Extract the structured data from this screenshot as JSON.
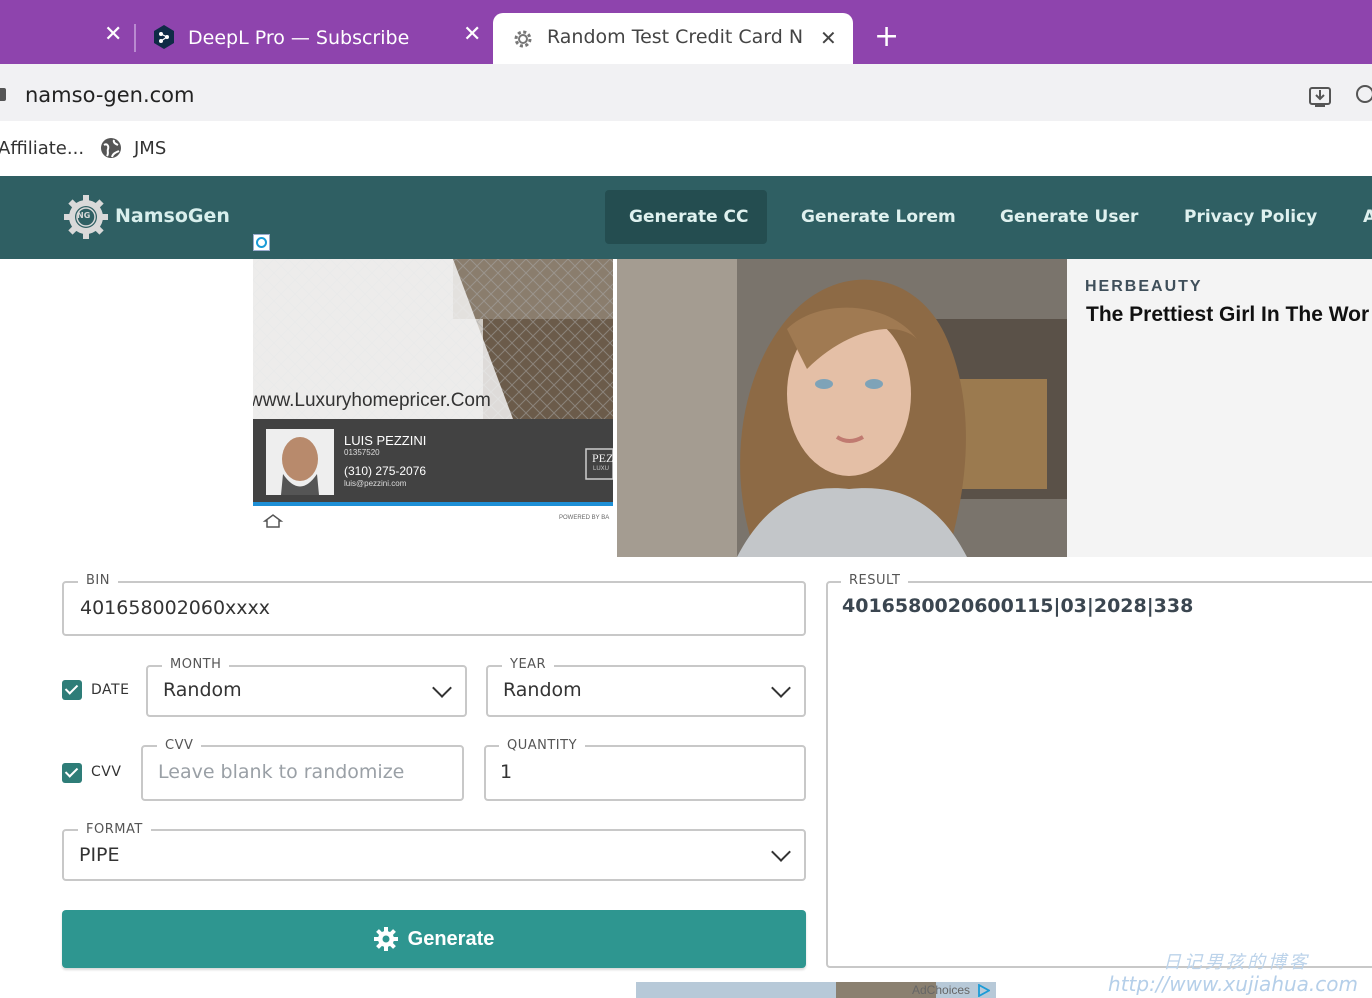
{
  "browser": {
    "tabs": [
      {
        "title": ""
      },
      {
        "title": "DeepL Pro — Subscribe"
      },
      {
        "title": "Random Test Credit Card Nun",
        "active": true
      }
    ],
    "url": "namso-gen.com",
    "bookmarks": [
      {
        "label": "Affiliate..."
      },
      {
        "label": "JMS"
      }
    ]
  },
  "site": {
    "brand": "NamsoGen",
    "logo_badge": "NG",
    "nav": [
      {
        "label": "Generate CC",
        "active": true
      },
      {
        "label": "Generate Lorem"
      },
      {
        "label": "Generate User"
      },
      {
        "label": "Privacy Policy"
      },
      {
        "label": "A"
      }
    ]
  },
  "ads": {
    "left": {
      "url_text": "www.Luxuryhomepricer.Com",
      "name": "LUIS PEZZINI",
      "license": "01357520",
      "phone": "(310) 275-2076",
      "email": "luis@pezzini.com",
      "logo_text": "PEZ",
      "logo_sub": "LUXU",
      "powered": "POWERED BY BA"
    },
    "right": {
      "sponsor": "HERBEAUTY",
      "headline": "The Prettiest Girl In The Wor"
    },
    "bottom": {
      "label": "AdChoices"
    }
  },
  "form": {
    "bin": {
      "label": "BIN",
      "value": "401658002060xxxx"
    },
    "date": {
      "label": "DATE",
      "checked": true
    },
    "month": {
      "label": "MONTH",
      "value": "Random"
    },
    "year": {
      "label": "YEAR",
      "value": "Random"
    },
    "cvv_toggle": {
      "label": "CVV",
      "checked": true
    },
    "cvv": {
      "label": "CVV",
      "placeholder": "Leave blank to randomize"
    },
    "quantity": {
      "label": "QUANTITY",
      "value": "1"
    },
    "format": {
      "label": "FORMAT",
      "value": "PIPE"
    },
    "generate_label": "Generate"
  },
  "result": {
    "label": "RESULT",
    "value": "4016580020600115|03|2028|338"
  },
  "watermark": {
    "line1": "日记男孩的博客",
    "line2": "http://www.xujiahua.com"
  },
  "colors": {
    "tabstrip": "#8e44ad",
    "sitenav": "#2f5f63",
    "accent": "#2e9690"
  }
}
